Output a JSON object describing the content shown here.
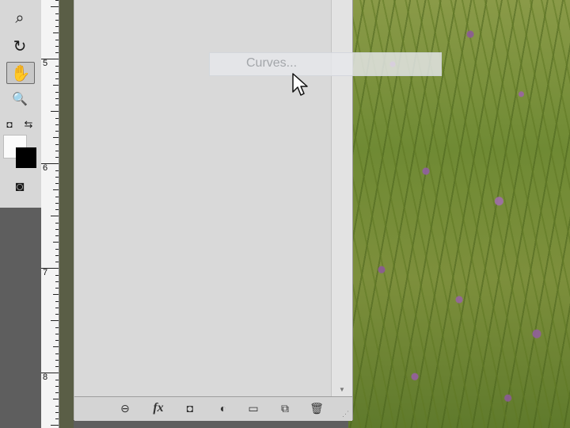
{
  "tools": {
    "items": [
      {
        "icon": "quick-selection-icon",
        "glyph": "⌕"
      },
      {
        "icon": "rotate-view-icon",
        "glyph": "↻"
      },
      {
        "icon": "hand-icon",
        "glyph": "✋",
        "active": true
      },
      {
        "icon": "zoom-icon",
        "glyph": "🔍"
      }
    ],
    "reset_colors_glyph": "◘",
    "swap_colors_glyph": "⇆",
    "quick_mask_glyph": "◙",
    "foreground_color": "#fbfbfb",
    "background_color": "#000000"
  },
  "ruler": {
    "labels": [
      "5",
      "6",
      "7",
      "8"
    ]
  },
  "layers_panel": {
    "scroll_down_glyph": "▼",
    "footer_buttons": [
      {
        "name": "link-layers-icon",
        "glyph": "⊖"
      },
      {
        "name": "layer-style-icon",
        "glyph": "fx"
      },
      {
        "name": "layer-mask-icon",
        "glyph": "◘"
      },
      {
        "name": "adjustment-layer-icon",
        "glyph": "◐"
      },
      {
        "name": "new-group-icon",
        "glyph": "▭"
      },
      {
        "name": "new-layer-icon",
        "glyph": "⧉"
      },
      {
        "name": "delete-layer-icon",
        "glyph": "🗑"
      }
    ],
    "grip_glyph": "⋰"
  },
  "drag": {
    "label": "Curves..."
  },
  "colors": {
    "panel_bg": "#d9d9d9",
    "workspace_bg": "#5e5e5e"
  }
}
